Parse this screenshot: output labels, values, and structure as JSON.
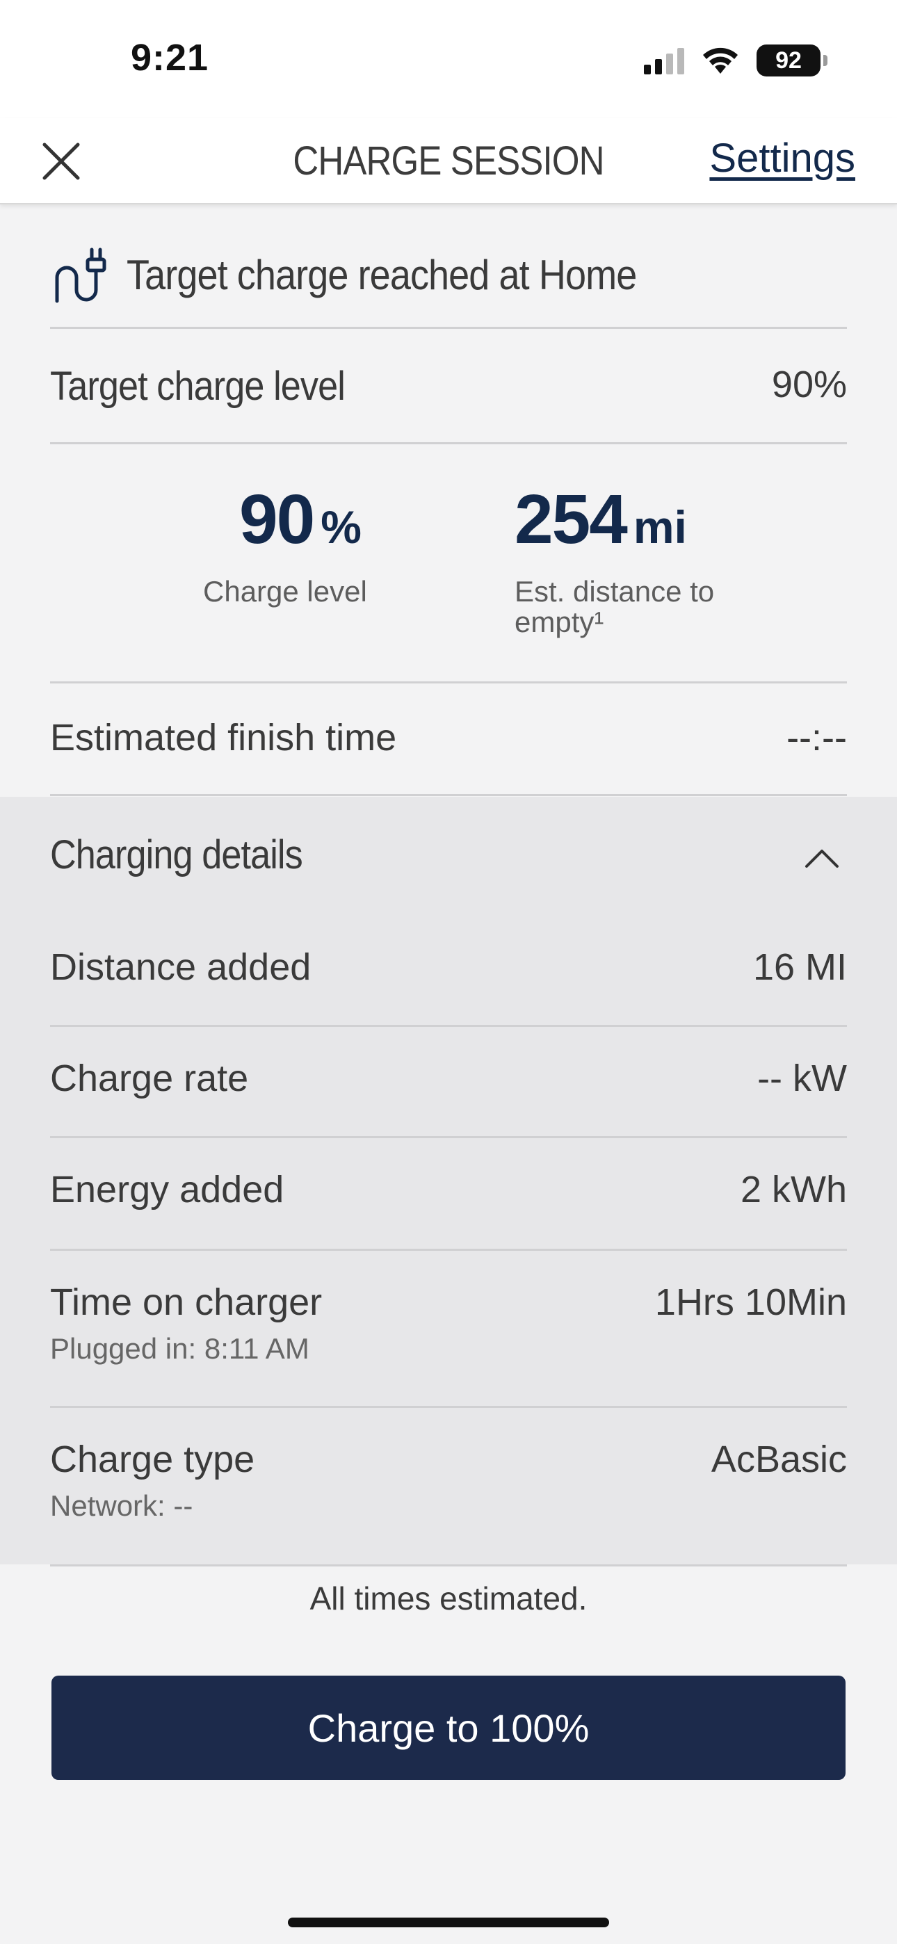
{
  "status_bar": {
    "time": "9:21",
    "battery": "92",
    "icons": [
      "cellular-signal-icon",
      "wifi-icon",
      "battery-icon"
    ]
  },
  "header": {
    "title": "CHARGE SESSION",
    "settings_label": "Settings",
    "close_icon": "close-icon"
  },
  "notice": {
    "icon": "plug-icon",
    "text": "Target charge reached at Home"
  },
  "target_charge": {
    "label": "Target charge level",
    "value": "90%"
  },
  "stats": {
    "charge_level": {
      "value": "90",
      "unit": "%",
      "caption": "Charge level"
    },
    "distance": {
      "value": "254",
      "unit": "mi",
      "caption_line1": "Est. distance to",
      "caption_line2": "empty¹"
    }
  },
  "finish_time": {
    "label": "Estimated finish time",
    "value": "--:--"
  },
  "charging_details": {
    "title": "Charging details",
    "expanded": true,
    "rows": [
      {
        "label": "Distance added",
        "value": "16 MI"
      },
      {
        "label": "Charge rate",
        "value": "-- kW"
      },
      {
        "label": "Energy added",
        "value": "2 kWh"
      },
      {
        "label": "Time on charger",
        "value": "1Hrs 10Min",
        "sublabel": "Plugged in: 8:11 AM"
      },
      {
        "label": "Charge type",
        "value": "AcBasic",
        "sublabel": "Network: --"
      }
    ]
  },
  "footnote": "All times estimated.",
  "cta_label": "Charge to 100%",
  "colors": {
    "brand_navy": "#13294b",
    "button_bg": "#1c2a4b",
    "page_bg": "#f3f3f4",
    "details_bg": "#e7e7e9"
  }
}
